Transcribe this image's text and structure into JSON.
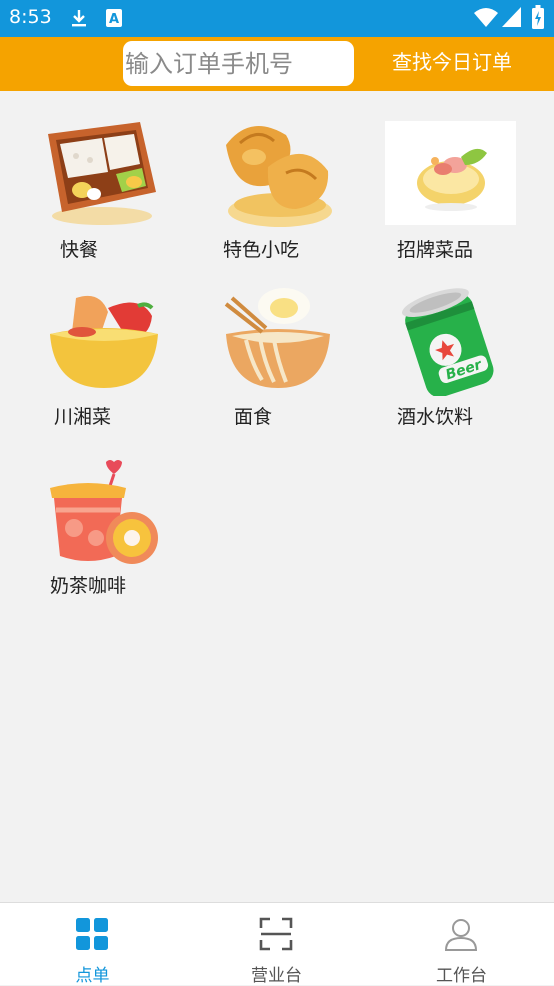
{
  "status_bar": {
    "time": "8:53",
    "icons": [
      "download-icon",
      "a-notification-icon",
      "wifi-icon",
      "signal-icon",
      "battery-charging-icon"
    ]
  },
  "header": {
    "search_placeholder": "输入订单手机号",
    "find_today_label": "查找今日订单"
  },
  "categories": [
    {
      "label": "快餐",
      "icon": "bento-box-icon"
    },
    {
      "label": "特色小吃",
      "icon": "buns-basket-icon"
    },
    {
      "label": "招牌菜品",
      "icon": "signature-dish-icon"
    },
    {
      "label": "川湘菜",
      "icon": "chili-bowl-icon"
    },
    {
      "label": "面食",
      "icon": "noodle-bowl-icon"
    },
    {
      "label": "酒水饮料",
      "icon": "beer-can-icon"
    },
    {
      "label": "奶茶咖啡",
      "icon": "milk-tea-icon"
    }
  ],
  "tabbar": {
    "tabs": [
      {
        "label": "点单",
        "active": true,
        "icon": "grid-icon"
      },
      {
        "label": "营业台",
        "active": false,
        "icon": "scan-icon"
      },
      {
        "label": "工作台",
        "active": false,
        "icon": "user-icon"
      }
    ]
  },
  "colors": {
    "status_bar": "#1296db",
    "header": "#f5a300",
    "active_tab": "#1296db",
    "inactive_tab": "#555555"
  }
}
